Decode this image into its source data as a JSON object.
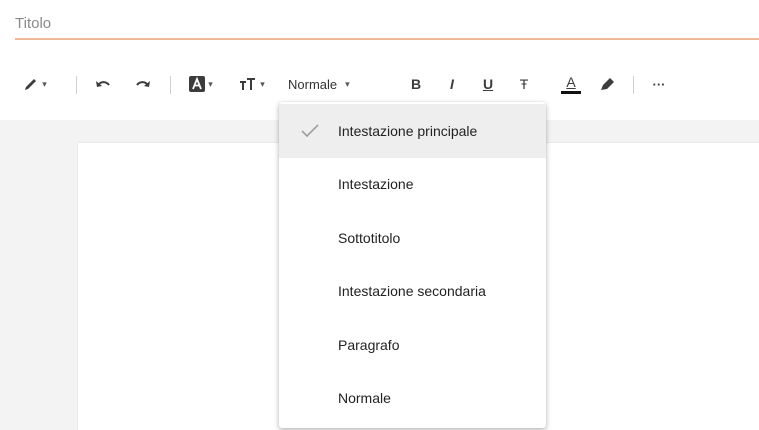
{
  "title": {
    "placeholder": "Titolo"
  },
  "toolbar": {
    "pen_icon": "pen-icon",
    "undo_icon": "undo-icon",
    "redo_icon": "redo-icon",
    "text_style_icon": "text-style-icon",
    "text_size_icon": "text-size-icon",
    "style_label": "Normale",
    "bold_label": "B",
    "italic_label": "I",
    "underline_label": "U",
    "strike_label": "Ŧ",
    "font_color_label": "A",
    "highlight_icon": "highlight-icon",
    "more_label": "···"
  },
  "dropdown": {
    "selected": "Intestazione principale",
    "options": [
      {
        "label": "Intestazione principale"
      },
      {
        "label": "Intestazione"
      },
      {
        "label": "Sottotitolo"
      },
      {
        "label": "Intestazione secondaria"
      },
      {
        "label": "Paragrafo"
      },
      {
        "label": "Normale"
      }
    ]
  },
  "colors": {
    "accent_underline": "#f1b899",
    "check": "#9e9e9e",
    "selected_bg": "#eeeeee"
  }
}
